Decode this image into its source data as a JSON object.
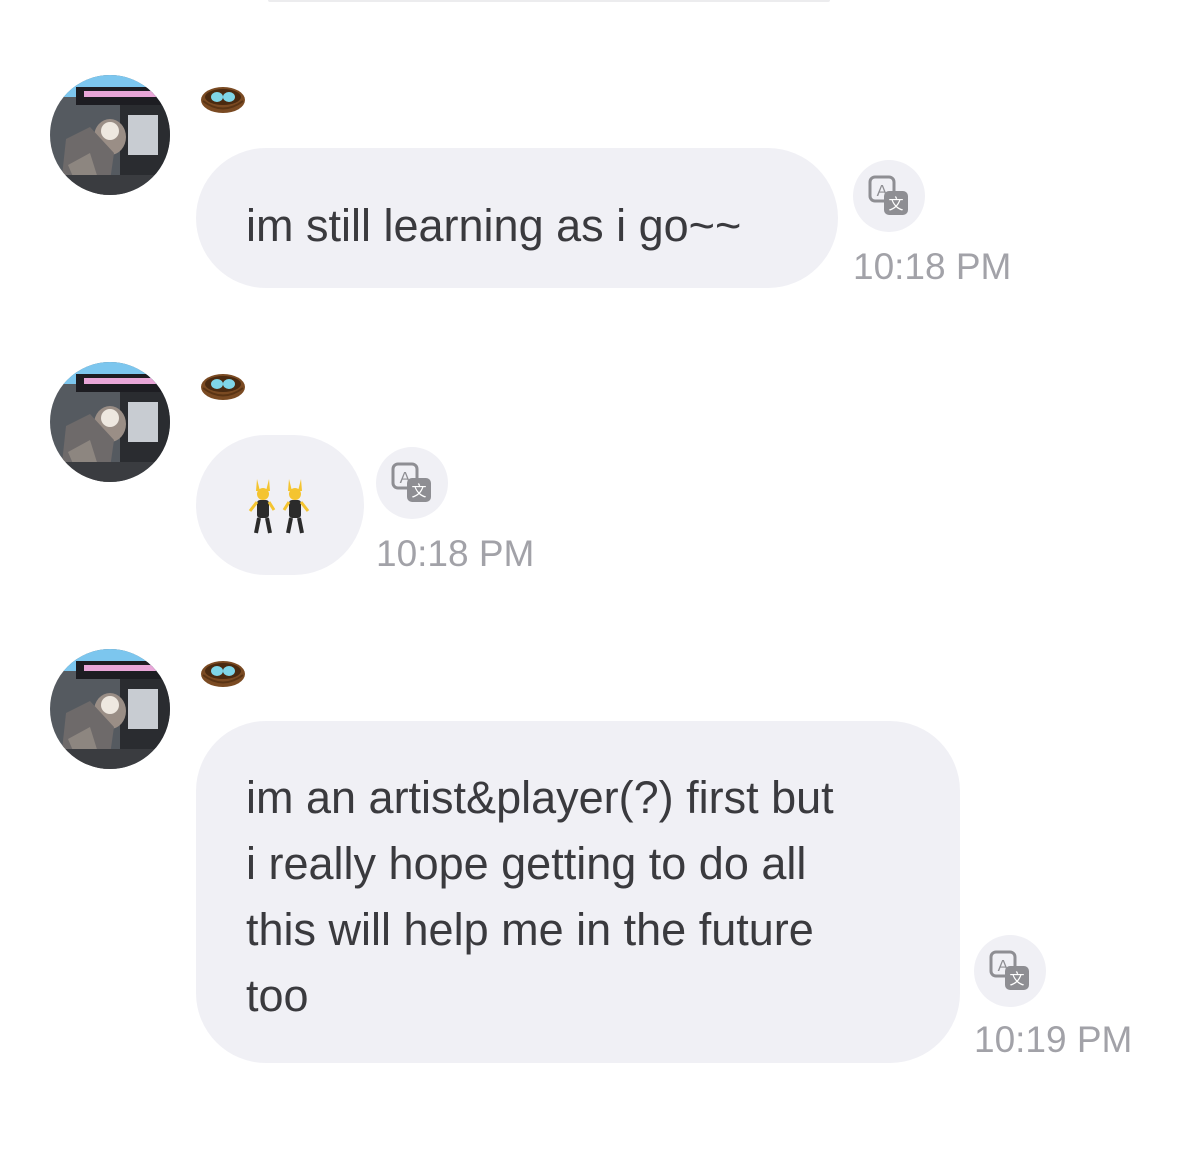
{
  "colors": {
    "bubble_bg": "#f0f0f5",
    "text": "#3a3a3e",
    "timestamp": "#a2a2a8"
  },
  "messages": [
    {
      "text": "im still learning as i go~~",
      "time": "10:18 PM",
      "avatar": "sender-avatar-photo",
      "badge_icon": "nest-icon",
      "action_icon": "translate-icon"
    },
    {
      "text": "👯",
      "content_icon": "women-with-bunny-ears-emoji",
      "time": "10:18 PM",
      "avatar": "sender-avatar-photo",
      "badge_icon": "nest-icon",
      "action_icon": "translate-icon"
    },
    {
      "text": "im an artist&player(?) first but\ni really hope getting to do all\nthis will help me in the future\ntoo",
      "time": "10:19 PM",
      "avatar": "sender-avatar-photo",
      "badge_icon": "nest-icon",
      "action_icon": "translate-icon"
    }
  ]
}
